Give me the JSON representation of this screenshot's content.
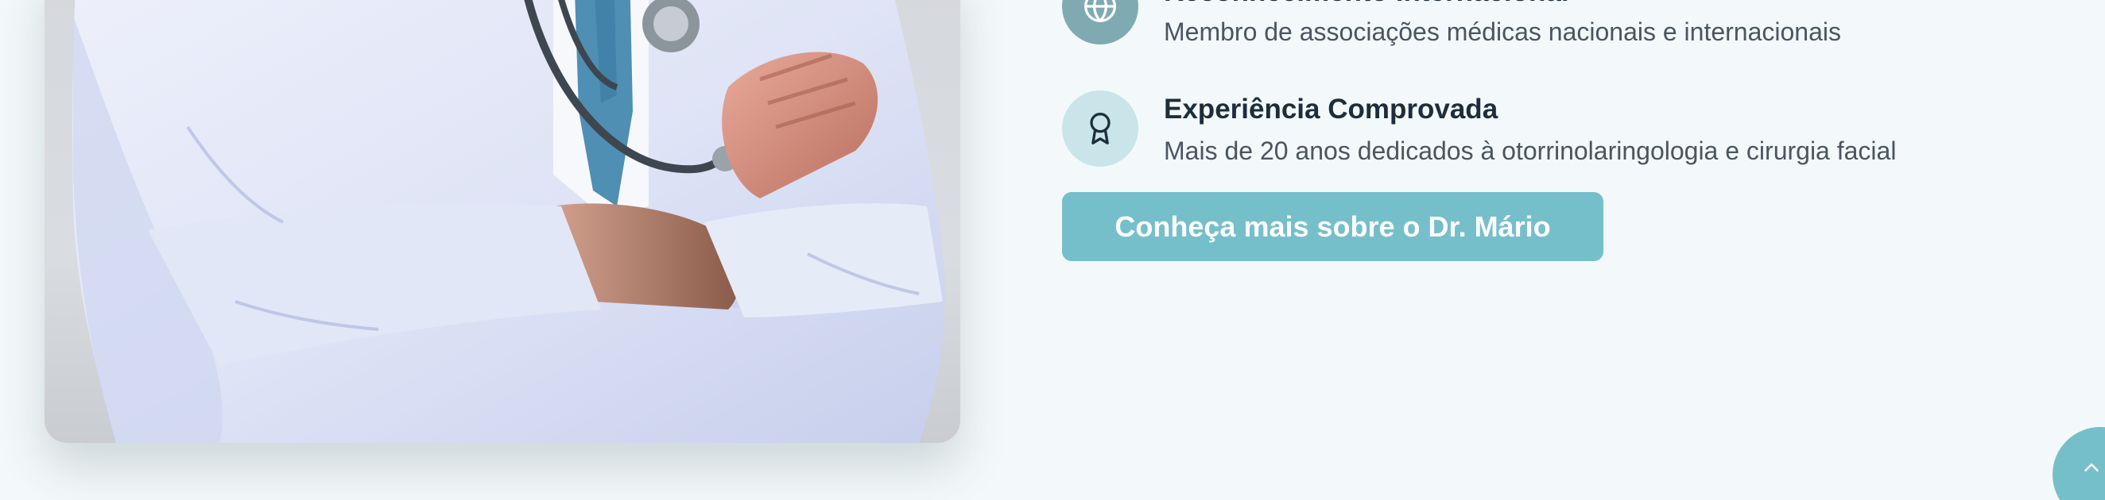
{
  "about": {
    "photo_alt": "doctor-photo",
    "features": [
      {
        "icon": "globe-icon",
        "title": "Reconhecimento Internacional",
        "description": "Membro de associações médicas nacionais e internacionais"
      },
      {
        "icon": "award-icon",
        "title": "Experiência Comprovada",
        "description": "Mais de 20 anos dedicados à otorrinolaringologia e cirurgia facial"
      }
    ],
    "cta_label": "Conheça mais sobre o Dr. Mário"
  },
  "colors": {
    "accent": "#75bfca",
    "icon_bg_dark": "#7faab2",
    "icon_bg_light": "#c9e5e9",
    "title_text": "#1e2d3b",
    "body_text": "#4a5560",
    "page_bg": "#f3f9fa"
  },
  "scroll_top": {
    "icon": "chevron-up-icon"
  }
}
